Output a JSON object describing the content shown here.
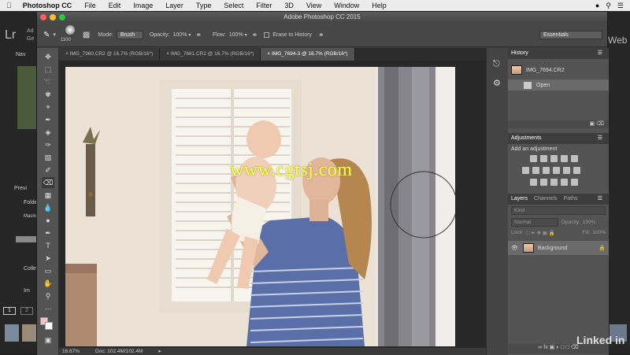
{
  "menubar": {
    "app_name": "Photoshop CC",
    "items": [
      "File",
      "Edit",
      "Image",
      "Layer",
      "Type",
      "Select",
      "Filter",
      "3D",
      "View",
      "Window",
      "Help"
    ]
  },
  "window": {
    "title": "Adobe Photoshop CC 2015"
  },
  "lightroom": {
    "logo": "Lr",
    "items": [
      "Ad",
      "Ge",
      "Nav",
      "Previ",
      "Folde",
      "Macin",
      "Colle",
      "Im"
    ],
    "right_text": "Web"
  },
  "options_bar": {
    "brush_size": "1100",
    "mode_label": "Mode:",
    "mode_value": "Brush",
    "opacity_label": "Opacity:",
    "opacity_value": "100%",
    "flow_label": "Flow:",
    "flow_value": "100%",
    "erase_to_history": "Erase to History",
    "workspace": "Essentials"
  },
  "tabs": [
    {
      "label": "IMG_7960.CR2 @ 16.7% (RGB/16*)",
      "active": false
    },
    {
      "label": "IMG_7681.CR2 @ 16.7% (RGB/16*)",
      "active": false
    },
    {
      "label": "IMG_7694-3 @ 16.7% (RGB/16*)",
      "active": true
    }
  ],
  "status_bar": {
    "zoom": "16.67%",
    "doc": "Doc: 102.4M/102.4M"
  },
  "history": {
    "title": "History",
    "snapshot": "IMG_7694.CR2",
    "step": "Open"
  },
  "adjustments": {
    "title": "Adjustments",
    "subtitle": "Add an adjustment"
  },
  "layers": {
    "tabs": [
      "Layers",
      "Channels",
      "Paths"
    ],
    "kind_placeholder": "Kind",
    "blend_mode": "Normal",
    "opacity_label": "Opacity:",
    "opacity_value": "100%",
    "lock_label": "Lock:",
    "fill_label": "Fill:",
    "fill_value": "100%",
    "layer_name": "Background"
  },
  "watermark": "www.cgtsj.com",
  "linkedin": "Linked in",
  "colors": {
    "accent": "#ffff33",
    "panel_bg": "#535353",
    "dark_bg": "#3c3c3c"
  }
}
